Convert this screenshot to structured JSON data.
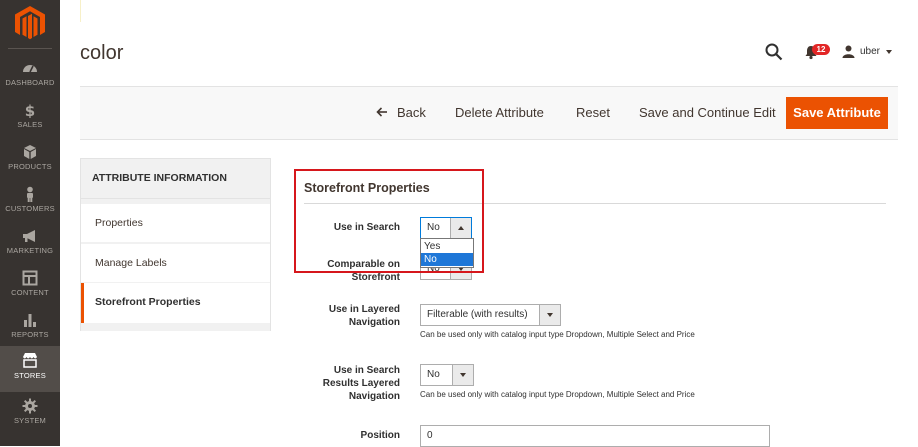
{
  "colors": {
    "accent": "#eb5202",
    "sidebar_bg": "#373330",
    "highlight": "#d6171c",
    "badge": "#e22626"
  },
  "sidebar": {
    "logo_icon": "magento-logo-icon",
    "items": [
      {
        "label": "DASHBOARD",
        "icon": "dashboard-icon"
      },
      {
        "label": "SALES",
        "icon": "dollar-icon"
      },
      {
        "label": "PRODUCTS",
        "icon": "cube-icon"
      },
      {
        "label": "CUSTOMERS",
        "icon": "person-icon"
      },
      {
        "label": "MARKETING",
        "icon": "megaphone-icon"
      },
      {
        "label": "CONTENT",
        "icon": "layout-icon"
      },
      {
        "label": "REPORTS",
        "icon": "bar-chart-icon"
      },
      {
        "label": "STORES",
        "icon": "store-icon",
        "active": true
      },
      {
        "label": "SYSTEM",
        "icon": "gear-icon"
      }
    ]
  },
  "header": {
    "title": "color",
    "notifications_count": "12",
    "user_name": "uber"
  },
  "actions": {
    "back": "Back",
    "delete": "Delete Attribute",
    "reset": "Reset",
    "save_continue": "Save and Continue Edit",
    "save": "Save Attribute"
  },
  "tabs": {
    "heading": "ATTRIBUTE INFORMATION",
    "items": [
      "Properties",
      "Manage Labels",
      "Storefront Properties"
    ],
    "active": "Storefront Properties"
  },
  "form": {
    "section_title": "Storefront Properties",
    "use_in_search": {
      "label": "Use in Search",
      "value": "No",
      "options": [
        "Yes",
        "No"
      ]
    },
    "comparable": {
      "label_line1": "Comparable on",
      "label_line2": "Storefront",
      "value": "No"
    },
    "layered_nav": {
      "label_line1": "Use in Layered",
      "label_line2": "Navigation",
      "value": "Filterable (with results)",
      "note": "Can be used only with catalog input type Dropdown, Multiple Select and Price"
    },
    "search_layered_nav": {
      "label_line1": "Use in Search",
      "label_line2": "Results Layered",
      "label_line3": "Navigation",
      "value": "No",
      "note": "Can be used only with catalog input type Dropdown, Multiple Select and Price"
    },
    "position": {
      "label": "Position",
      "value": "0"
    }
  }
}
